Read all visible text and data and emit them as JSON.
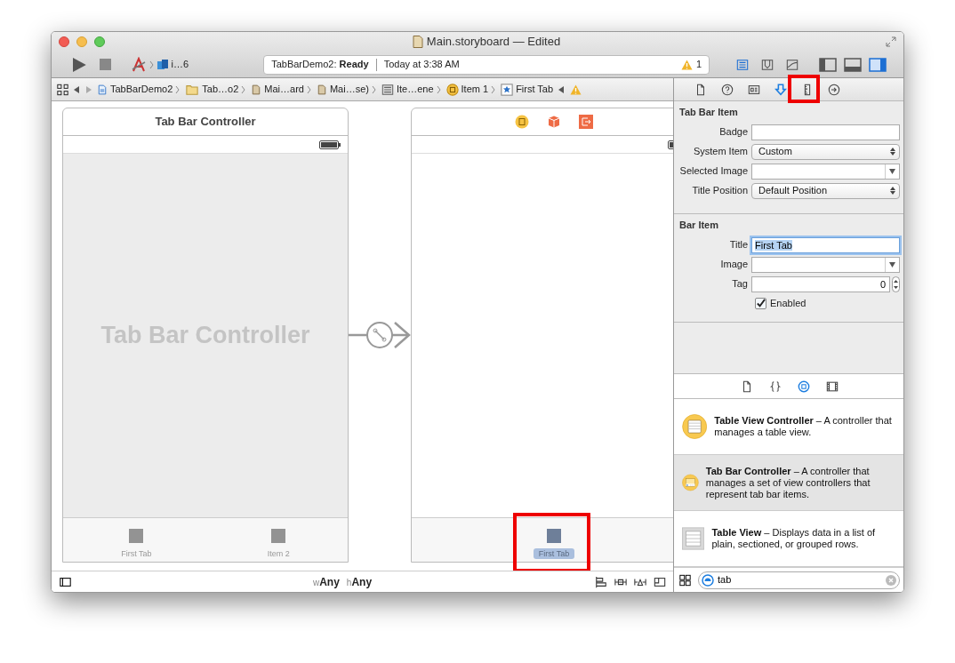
{
  "window": {
    "title": "Main.storyboard — Edited"
  },
  "toolbar": {
    "scheme": "i…6",
    "status": {
      "project": "TabBarDemo2:",
      "state": "Ready",
      "time": "Today at 3:38 AM",
      "warning_count": "1"
    },
    "editor_modes": [
      {
        "kind": "standard",
        "selected": true
      },
      {
        "kind": "assistant",
        "selected": false
      },
      {
        "kind": "version",
        "selected": false
      }
    ],
    "view_toggles": [
      {
        "kind": "navigator",
        "selected": false
      },
      {
        "kind": "debug",
        "selected": false
      },
      {
        "kind": "utilities",
        "selected": true
      }
    ]
  },
  "breadcrumbs": [
    {
      "label": "TabBarDemo2",
      "kind": "project"
    },
    {
      "label": "Tab…o2",
      "kind": "folder"
    },
    {
      "label": "Mai…ard",
      "kind": "file"
    },
    {
      "label": "Mai…se)",
      "kind": "file"
    },
    {
      "label": "Ite…ene",
      "kind": "scene"
    },
    {
      "label": "Item 1",
      "kind": "controller"
    },
    {
      "label": "First Tab",
      "kind": "item"
    }
  ],
  "inspector_tabs": [
    {
      "kind": "file",
      "selected": false
    },
    {
      "kind": "help",
      "selected": false
    },
    {
      "kind": "identity",
      "selected": false
    },
    {
      "kind": "attributes",
      "selected": true
    },
    {
      "kind": "size",
      "selected": false
    },
    {
      "kind": "connections",
      "selected": false
    }
  ],
  "inspector_sections": [
    {
      "title": "Tab Bar Item",
      "fields": [
        {
          "label": "Badge",
          "kind": "text"
        },
        {
          "label": "System Item",
          "kind": "popup",
          "value": "Custom"
        },
        {
          "label": "Selected Image",
          "kind": "combo"
        },
        {
          "label": "Title Position",
          "kind": "popup",
          "value": "Default Position"
        }
      ]
    },
    {
      "title": "Bar Item",
      "fields": [
        {
          "label": "Title",
          "kind": "text",
          "value": "First Tab",
          "focused": true
        },
        {
          "label": "Image",
          "kind": "combo"
        },
        {
          "label": "Tag",
          "kind": "stepper",
          "value": "0"
        },
        {
          "label": "Enabled",
          "kind": "checkbox",
          "checked": true
        }
      ]
    }
  ],
  "library_tabs": [
    {
      "kind": "file",
      "selected": false
    },
    {
      "kind": "code",
      "selected": false
    },
    {
      "kind": "object",
      "selected": true
    },
    {
      "kind": "media",
      "selected": false
    }
  ],
  "library_items": [
    {
      "text": "**Table View Controller** – A controller that manages a table view.",
      "kind": "table-controller",
      "selected": false
    },
    {
      "text": "**Tab Bar Controller** – A controller that manages a set of view controllers that represent tab bar items.",
      "kind": "tab-controller",
      "selected": true
    },
    {
      "text": "**Table View** – Displays data in a list of plain, sectioned, or grouped rows.",
      "kind": "table-view",
      "selected": false
    }
  ],
  "library_search": {
    "value": "tab"
  },
  "canvas": {
    "scenes": [
      {
        "title": "Tab Bar Controller",
        "placeholder_label": "Tab Bar Controller",
        "tab_items": [
          {
            "label": "First Tab",
            "selected": false
          },
          {
            "label": "Item 2",
            "selected": false
          }
        ]
      },
      {
        "tab_items": [
          {
            "label": "First Tab",
            "selected": true
          }
        ]
      }
    ]
  },
  "size_class": {
    "width_label": "w",
    "width": "Any",
    "height_label": "h",
    "height": "Any"
  }
}
